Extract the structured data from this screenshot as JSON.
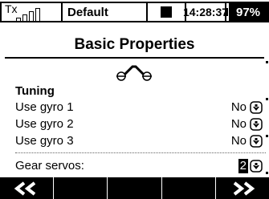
{
  "status": {
    "tx_label": "Tx",
    "model": "Default",
    "time": "14:28:37",
    "battery": "97%"
  },
  "title": "Basic Properties",
  "tuning": {
    "section_label": "Tuning",
    "rows": [
      {
        "label": "Use gyro 1",
        "value": "No"
      },
      {
        "label": "Use gyro 2",
        "value": "No"
      },
      {
        "label": "Use gyro 3",
        "value": "No"
      }
    ]
  },
  "gear": {
    "label": "Gear servos:",
    "value": "2"
  },
  "icons": {
    "signal": "signal-bars-icon",
    "heli": "helicopter-rotor-icon",
    "dropdown": "dropdown-arrow-icon",
    "prev": "double-left-arrow-icon",
    "next": "double-right-arrow-icon"
  }
}
